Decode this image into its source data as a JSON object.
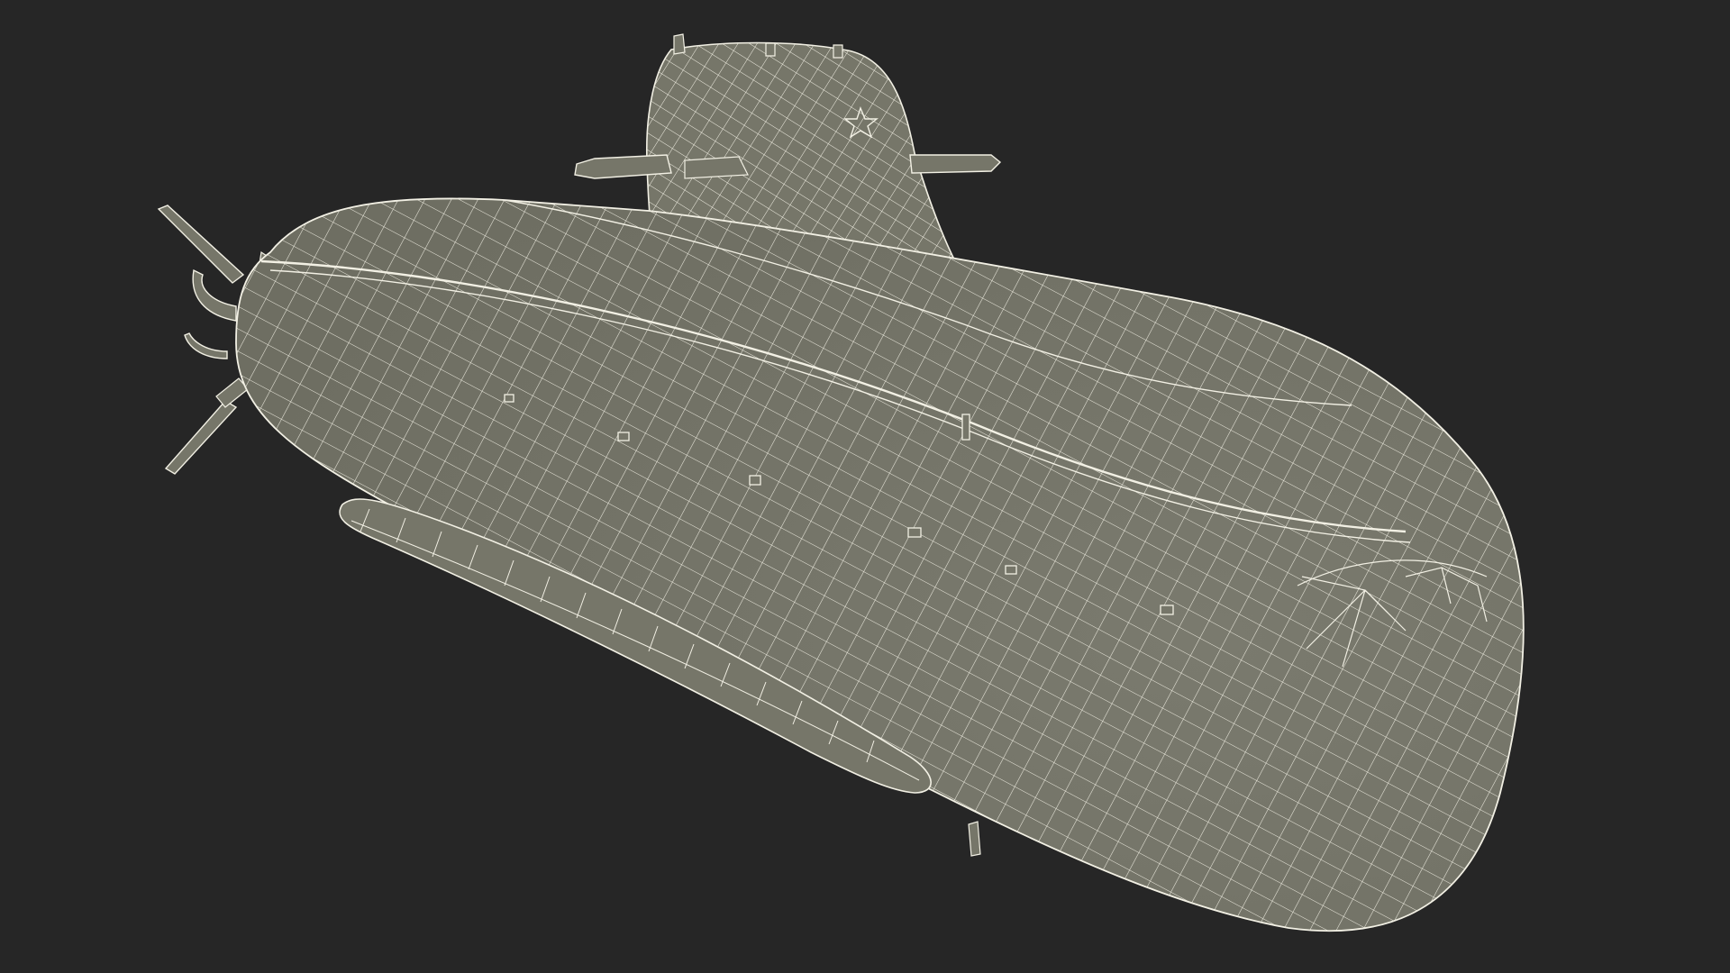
{
  "scene": {
    "background_color": "#262626",
    "model_fill_color": "#767669",
    "wire_color": "#f2f0e4",
    "subject": "submarine-wireframe-render"
  }
}
